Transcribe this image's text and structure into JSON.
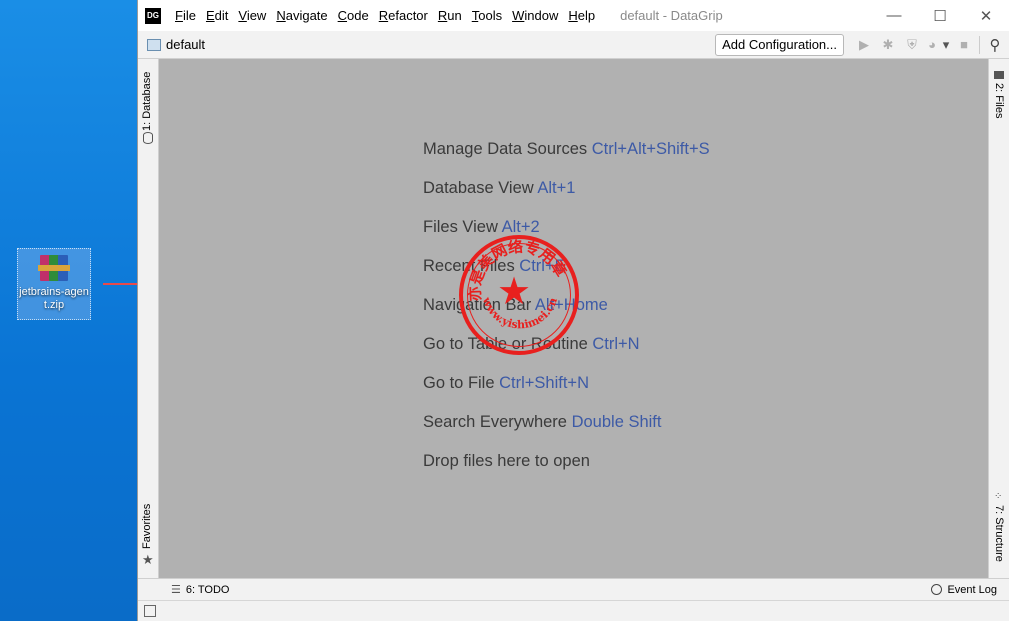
{
  "desktop": {
    "file_label": "jetbrains-agent.zip"
  },
  "window": {
    "logo_text": "DG",
    "title": "default - DataGrip",
    "menu": [
      {
        "ul": "F",
        "rest": "ile"
      },
      {
        "ul": "E",
        "rest": "dit"
      },
      {
        "ul": "V",
        "rest": "iew"
      },
      {
        "ul": "N",
        "rest": "avigate"
      },
      {
        "ul": "C",
        "rest": "ode"
      },
      {
        "ul": "R",
        "rest": "efactor"
      },
      {
        "ul": "R",
        "rest": "un"
      },
      {
        "ul": "T",
        "rest": "ools"
      },
      {
        "ul": "W",
        "rest": "indow"
      },
      {
        "ul": "H",
        "rest": "elp"
      }
    ],
    "controls": {
      "minimize": "—",
      "maximize": "☐",
      "close": "✕"
    }
  },
  "toolbar": {
    "project_name": "default",
    "add_configuration": "Add Configuration...",
    "icons": {
      "run": "▶",
      "debug": "✱",
      "coverage": "⛨",
      "profile": "◕",
      "dropdown": "▾",
      "stop": "■",
      "search": "⚲"
    }
  },
  "sidebar_left": {
    "database_tab": "1: Database",
    "favorites_tab": "Favorites",
    "database_icon": "database-icon",
    "star_icon": "★"
  },
  "sidebar_right": {
    "files_tab": "2: Files",
    "structure_tab": "7: Structure"
  },
  "editor": {
    "hints": [
      {
        "text": "Manage Data Sources ",
        "key": "Ctrl+Alt+Shift+S"
      },
      {
        "text": "Database View ",
        "key": "Alt+1"
      },
      {
        "text": "Files View ",
        "key": "Alt+2"
      },
      {
        "text": "Recent Files ",
        "key": "Ctrl+E"
      },
      {
        "text": "Navigation Bar ",
        "key": "Alt+Home"
      },
      {
        "text": "Go to Table or Routine ",
        "key": "Ctrl+N"
      },
      {
        "text": "Go to File ",
        "key": "Ctrl+Shift+N"
      },
      {
        "text": "Search Everywhere ",
        "key": "Double Shift"
      },
      {
        "text": "Drop files here to open",
        "key": ""
      }
    ],
    "stamp": {
      "top_text": "亦是美网络专用章",
      "url": "www.yishimei.cn",
      "star": "★",
      "color": "#e8201e"
    }
  },
  "bottom": {
    "todo_label": "6: TODO",
    "event_log": "Event Log"
  },
  "colors": {
    "editor_bg": "#b1b1b1",
    "shortcut": "#3d5aa6",
    "arrow": "#e84a4a"
  }
}
